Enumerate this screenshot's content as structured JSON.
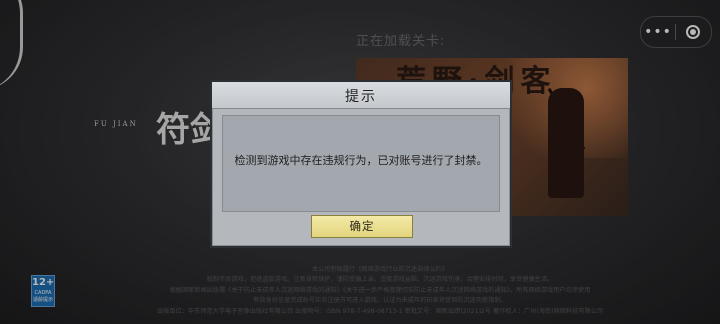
{
  "loading": {
    "text": "正在加载关卡:"
  },
  "capsule": {
    "more_label": "•••",
    "more_icon": "more-dots-icon",
    "close_icon": "close-ring-icon"
  },
  "logo": {
    "pinyin": "FU JIAN",
    "title": "符剑"
  },
  "banner": {
    "title": "荒野·剑客"
  },
  "age_rating": {
    "value": "12+",
    "caption": "CADPA 适龄提示"
  },
  "footer": {
    "lines": [
      "本公司积极履行《网络游戏行业防沉迷自律公约》",
      "抵制不良游戏，拒绝盗版游戏。注意自我保护，谨防受骗上当。适度游戏益脑，沉迷游戏伤身。合理安排时间，享受健康生活。",
      "根据国家新闻出版署《关于防止未成年人沉迷网络游戏的通知》《关于进一步严格管理切实防止未成年人沉迷网络游戏的通知》，所有网络游戏用户均须使用",
      "有效身份信息完成账号实名注册方可进入游戏，认证为未成年的玩家将受到防沉迷功能限制。",
      "出版单位：华东师范大学电子音像出版社有限公司 出版物号：ISBN 978-7-498-08713-1 审批文号：国新出审[2021]2号 著作权人：广州(海南)网络科技有限公司"
    ]
  },
  "dialog": {
    "title": "提示",
    "message": "检测到游戏中存在违规行为，已对账号进行了封禁。",
    "confirm_label": "确定"
  },
  "colors": {
    "dialog_bg": "#b4b8bd",
    "button_bg": "#efe39a",
    "age_badge": "#1e6fb4"
  }
}
